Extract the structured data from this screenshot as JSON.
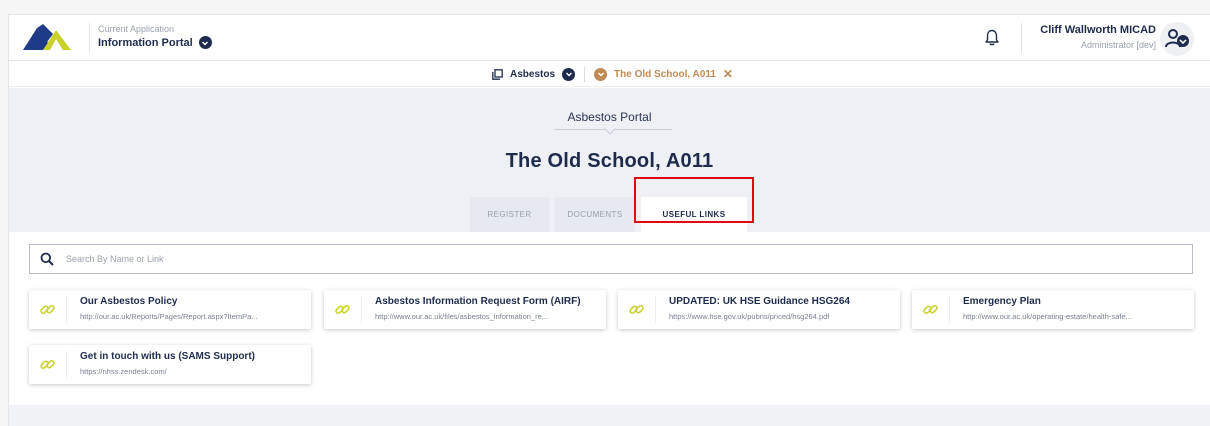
{
  "header": {
    "app_caption": "Current Application",
    "app_name": "Information Portal",
    "user_name": "Cliff Wallworth MICAD",
    "user_role": "Administrator [dev]"
  },
  "context": {
    "module": "Asbestos",
    "location": "The Old School, A011",
    "close_glyph": "✕"
  },
  "banner": {
    "portal_label": "Asbestos Portal",
    "site_title": "The Old School, A011"
  },
  "tabs": [
    {
      "label": "REGISTER",
      "active": false
    },
    {
      "label": "DOCUMENTS",
      "active": false
    },
    {
      "label": "USEFUL LINKS",
      "active": true
    }
  ],
  "search": {
    "placeholder": "Search By Name or Link",
    "value": ""
  },
  "links": [
    {
      "title": "Our Asbestos Policy",
      "url": "http://our.ac.uk/Reports/Pages/Report.aspx?ItemPa..."
    },
    {
      "title": "Asbestos Information Request Form (AIRF)",
      "url": "http://www.our.ac.uk/files/asbestos_information_re..."
    },
    {
      "title": "UPDATED: UK HSE Guidance HSG264",
      "url": "https://www.hse.gov.uk/pubns/priced/hsg264.pdf"
    },
    {
      "title": "Emergency Plan",
      "url": "http://www.our.ac.uk/operating-estate/health-safe..."
    },
    {
      "title": "Get in touch with us (SAMS Support)",
      "url": "https://nhss.zendesk.com/"
    }
  ],
  "colors": {
    "navy": "#1f2b4d",
    "accent_tan": "#c08a55",
    "link_icon": "#c8d22a",
    "highlight_red": "#e30613"
  },
  "icons": {
    "logo": "brand-mountain-logo",
    "bell": "bell-icon",
    "avatar": "user-avatar-icon",
    "module": "copy-icon",
    "search": "search-icon",
    "link": "link-icon"
  }
}
